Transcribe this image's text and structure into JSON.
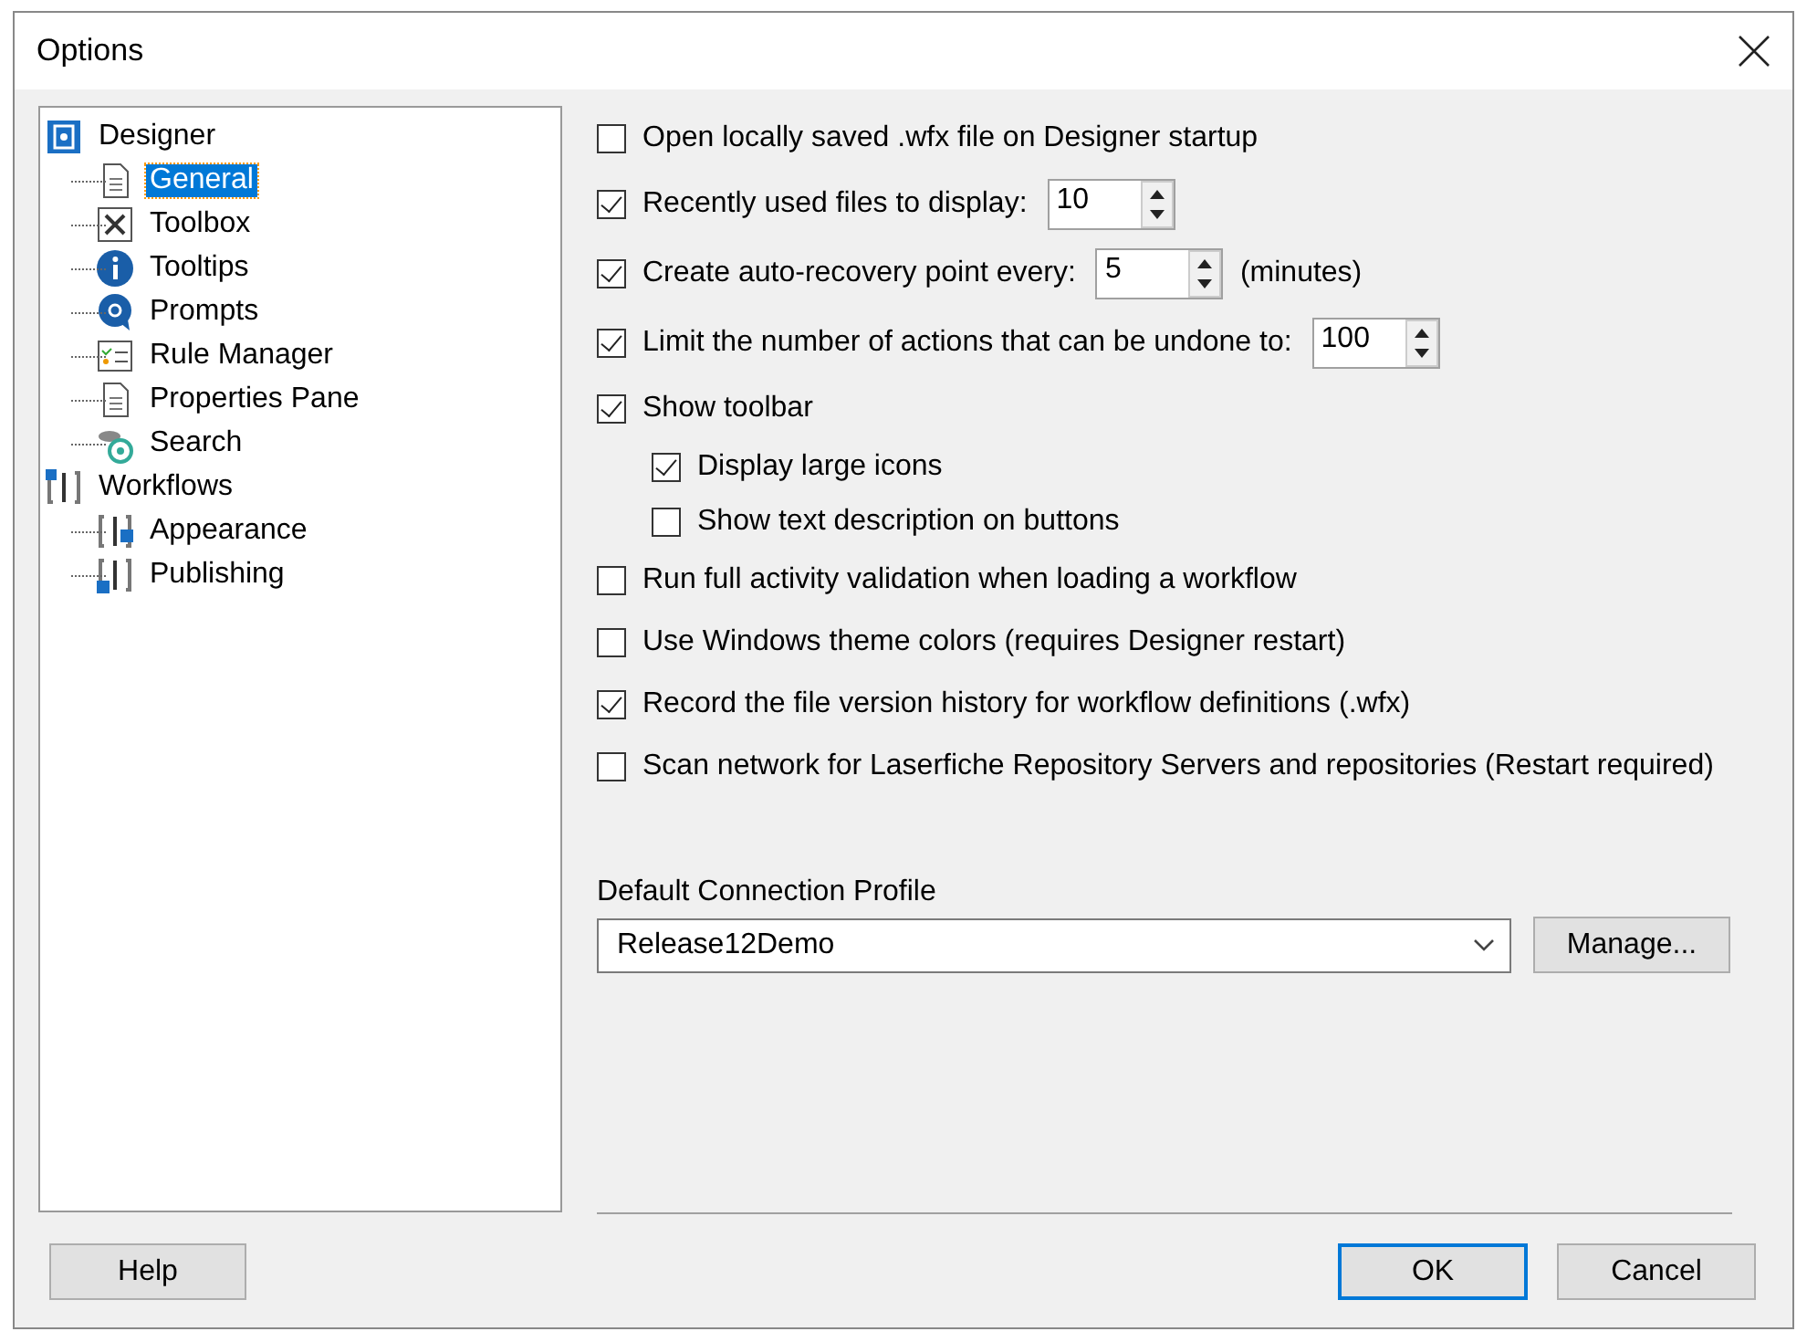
{
  "window": {
    "title": "Options"
  },
  "tree": [
    {
      "label": "Designer",
      "selected": false,
      "children": [
        {
          "label": "General",
          "selected": true
        },
        {
          "label": "Toolbox",
          "selected": false
        },
        {
          "label": "Tooltips",
          "selected": false
        },
        {
          "label": "Prompts",
          "selected": false
        },
        {
          "label": "Rule Manager",
          "selected": false
        },
        {
          "label": "Properties Pane",
          "selected": false
        },
        {
          "label": "Search",
          "selected": false
        }
      ]
    },
    {
      "label": "Workflows",
      "selected": false,
      "children": [
        {
          "label": "Appearance",
          "selected": false
        },
        {
          "label": "Publishing",
          "selected": false
        }
      ]
    }
  ],
  "options": [
    {
      "kind": "check",
      "label": "Open locally saved .wfx file on Designer startup",
      "checked": false
    },
    {
      "kind": "spin",
      "label": "Recently used files to display:",
      "checked": true,
      "value": "10"
    },
    {
      "kind": "spin",
      "label": "Create auto-recovery point every:",
      "checked": true,
      "value": "5",
      "suffix": "(minutes)"
    },
    {
      "kind": "spin",
      "label": "Limit the number of actions that can be undone to:",
      "checked": true,
      "value": "100"
    },
    {
      "kind": "check",
      "label": "Show toolbar",
      "checked": true,
      "children": [
        {
          "kind": "check",
          "label": "Display large icons",
          "checked": true
        },
        {
          "kind": "check",
          "label": "Show text description on buttons",
          "checked": false
        }
      ]
    },
    {
      "kind": "check",
      "label": "Run full activity validation when loading a workflow",
      "checked": false
    },
    {
      "kind": "check",
      "label": "Use Windows theme colors (requires Designer restart)",
      "checked": false
    },
    {
      "kind": "check",
      "label": "Record the file version history for workflow definitions (.wfx)",
      "checked": true
    },
    {
      "kind": "check",
      "label": "Scan network for Laserfiche Repository Servers and repositories (Restart required)",
      "checked": false
    }
  ],
  "profile": {
    "label": "Default Connection Profile",
    "value": "Release12Demo",
    "button": "Manage..."
  },
  "buttons": {
    "help": "Help",
    "ok": "OK",
    "cancel": "Cancel"
  }
}
